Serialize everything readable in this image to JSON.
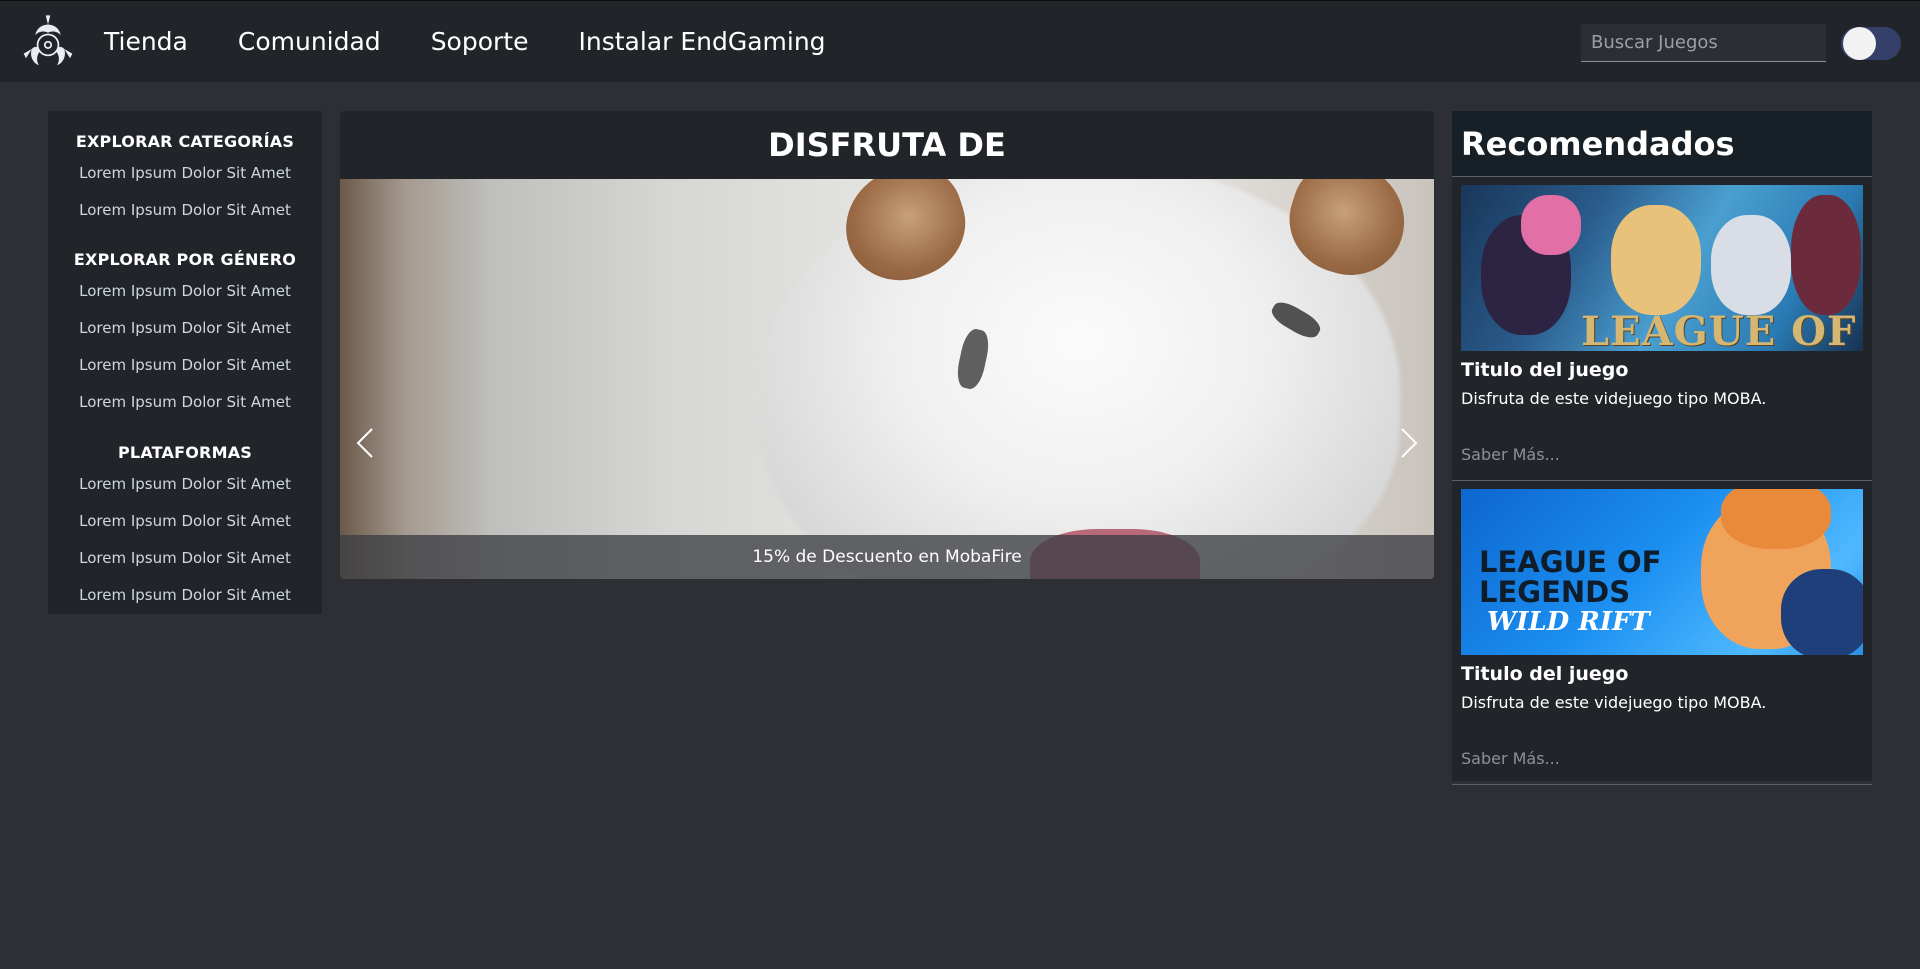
{
  "navbar": {
    "logo_icon": "biohazard-logo-icon",
    "links": [
      "Tienda",
      "Comunidad",
      "Soporte",
      "Instalar EndGaming"
    ],
    "search_placeholder": "Buscar Juegos",
    "theme_toggle_on": true
  },
  "sidebar": {
    "sections": [
      {
        "heading": "EXPLORAR CATEGORÍAS",
        "items": [
          "Lorem Ipsum Dolor Sit Amet",
          "Lorem Ipsum Dolor Sit Amet"
        ]
      },
      {
        "heading": "EXPLORAR POR GÉNERO",
        "items": [
          "Lorem Ipsum Dolor Sit Amet",
          "Lorem Ipsum Dolor Sit Amet",
          "Lorem Ipsum Dolor Sit Amet",
          "Lorem Ipsum Dolor Sit Amet"
        ]
      },
      {
        "heading": "PLATAFORMAS",
        "items": [
          "Lorem Ipsum Dolor Sit Amet",
          "Lorem Ipsum Dolor Sit Amet",
          "Lorem Ipsum Dolor Sit Amet",
          "Lorem Ipsum Dolor Sit Amet"
        ]
      }
    ]
  },
  "feature": {
    "title": "DISFRUTA DE",
    "caption": "15% de Descuento en MobaFire",
    "prev_icon": "chevron-left-icon",
    "next_icon": "chevron-right-icon"
  },
  "recommended": {
    "title": "Recomendados",
    "cards": [
      {
        "image_text": "LEAGUE OF",
        "name": "Titulo del juego",
        "desc": "Disfruta de este videjuego tipo MOBA.",
        "more": "Saber Más..."
      },
      {
        "image_text_line1": "LEAGUE OF",
        "image_text_line2": "LEGENDS",
        "image_text_line3": "WILD RIFT",
        "name": "Titulo del juego",
        "desc": "Disfruta de este videjuego tipo MOBA.",
        "more": "Saber Más..."
      }
    ]
  },
  "colors": {
    "page_bg": "#2d2f34",
    "panel_bg": "#212529",
    "recs_header_bg": "#172026",
    "toggle_track": "#35406a",
    "muted_link": "#8c9197"
  }
}
